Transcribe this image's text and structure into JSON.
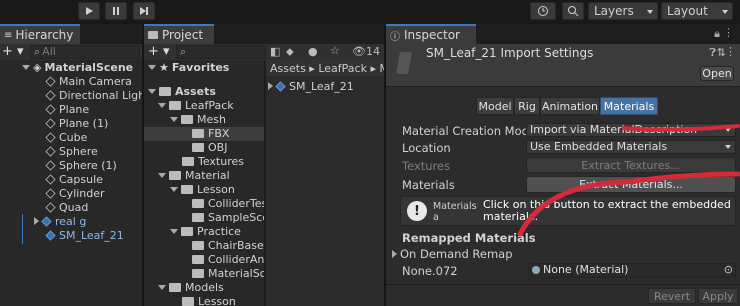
{
  "toolbar": {
    "layers_label": "Layers",
    "layout_label": "Layout"
  },
  "hierarchy": {
    "title": "Hierarchy",
    "search_placeholder": "All",
    "scene": "MaterialScene",
    "items": [
      "Main Camera",
      "Directional Light",
      "Plane",
      "Plane (1)",
      "Cube",
      "Sphere",
      "Sphere (1)",
      "Capsule",
      "Cylinder",
      "Quad",
      "real g",
      "SM_Leaf_21"
    ]
  },
  "project": {
    "title": "Project",
    "badge_count": "14",
    "favorites": "Favorites",
    "tree": [
      "Assets",
      "LeafPack",
      "Mesh",
      "FBX",
      "OBJ",
      "Textures",
      "Material",
      "Lesson",
      "ColliderTes",
      "SampleSce",
      "Practice",
      "ChairBaseM",
      "ColliderAnd",
      "MaterialSc",
      "Models",
      "Lesson"
    ],
    "breadcrumb": [
      "Assets",
      "LeafPack",
      "M"
    ],
    "file": "SM_Leaf_21"
  },
  "inspector": {
    "title": "Inspector",
    "asset_title": "SM_Leaf_21 Import Settings",
    "open_button": "Open",
    "tabs": [
      "Model",
      "Rig",
      "Animation",
      "Materials"
    ],
    "active_tab": "Materials",
    "fields": {
      "creation_mode_label": "Material Creation Mode",
      "creation_mode_value": "Import via MaterialDescription",
      "location_label": "Location",
      "location_value": "Use Embedded Materials",
      "textures_label": "Textures",
      "extract_textures": "Extract Textures...",
      "materials_label": "Materials",
      "extract_materials": "Extract Materials..."
    },
    "info_text": "Materials a assignmen",
    "annotation": "Click on this button to extract the embedded materials.",
    "remapped_title": "Remapped Materials",
    "on_demand": "On Demand Remap",
    "remap_name": "None.072",
    "remap_value": "None (Material)",
    "revert": "Revert",
    "apply": "Apply"
  },
  "colors": {
    "accent_tab": "#3a79bb",
    "annotation_red": "#d42b3a",
    "active_tab_bg": "#4672a4"
  }
}
